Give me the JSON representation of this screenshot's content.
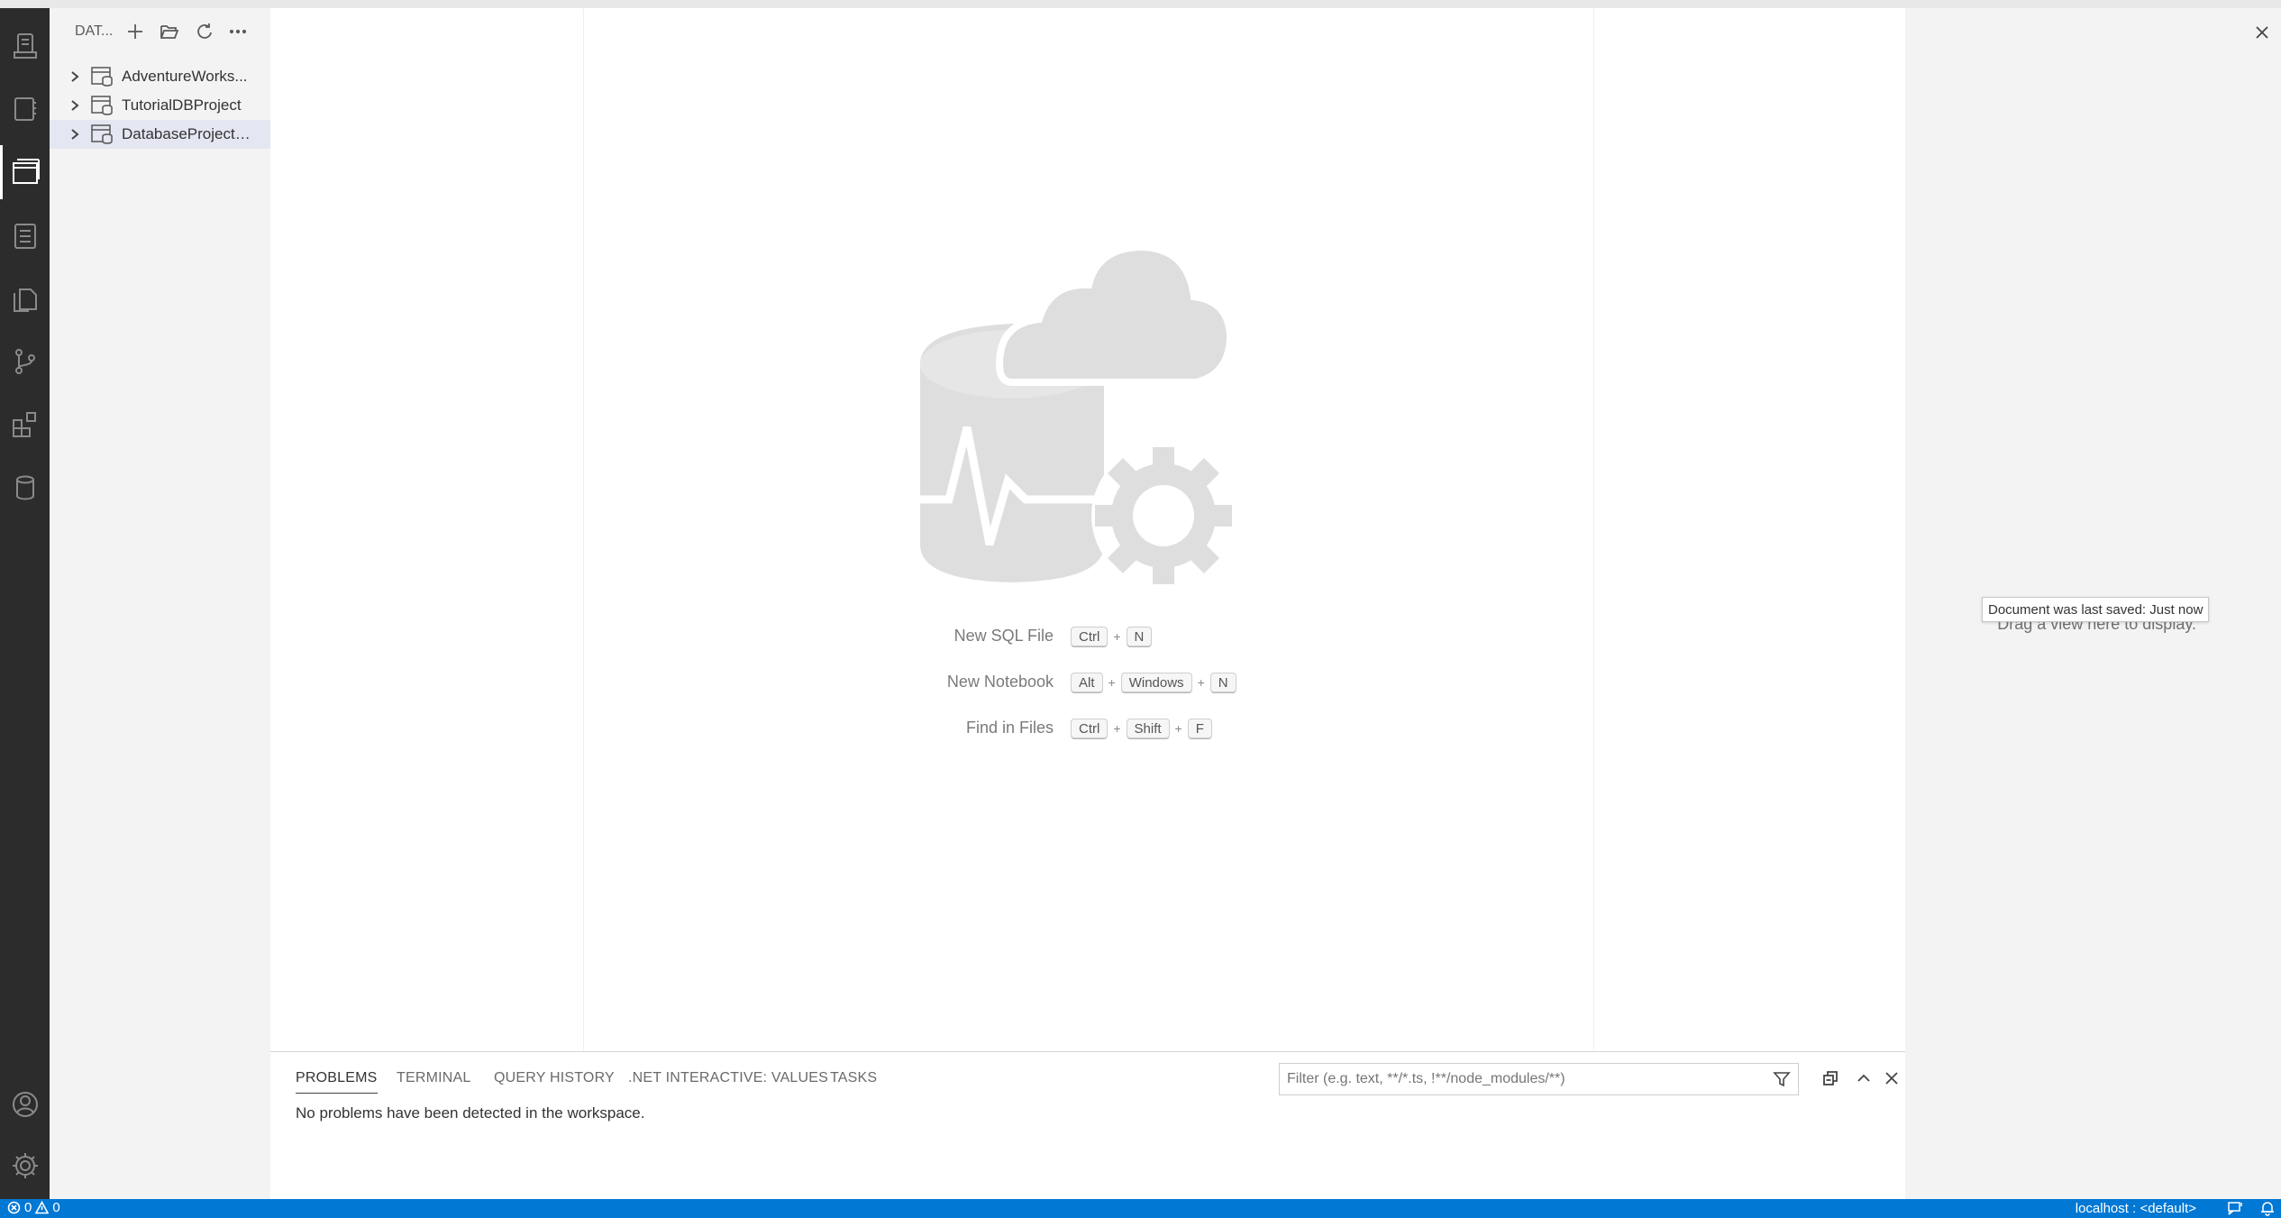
{
  "sidebar": {
    "title": "DAT...",
    "actions": [
      "new-project",
      "open-project",
      "refresh",
      "more"
    ],
    "items": [
      {
        "label": "AdventureWorks..."
      },
      {
        "label": "TutorialDBProject"
      },
      {
        "label": "DatabaseProjectT..."
      }
    ]
  },
  "welcome": {
    "shortcuts": [
      {
        "label": "New SQL File",
        "keys": [
          "Ctrl",
          "N"
        ]
      },
      {
        "label": "New Notebook",
        "keys": [
          "Alt",
          "Windows",
          "N"
        ]
      },
      {
        "label": "Find in Files",
        "keys": [
          "Ctrl",
          "Shift",
          "F"
        ]
      }
    ],
    "plus": "+"
  },
  "right_panel": {
    "drag_hint": "Drag a view here to display.",
    "tooltip": "Document was last saved: Just now"
  },
  "panel": {
    "tabs": [
      {
        "label": "PROBLEMS",
        "active": true
      },
      {
        "label": "TERMINAL",
        "active": false
      },
      {
        "label": "QUERY HISTORY",
        "active": false
      },
      {
        "label": ".NET INTERACTIVE: VALUES",
        "active": false
      },
      {
        "label": "TASKS",
        "active": false
      }
    ],
    "filter_placeholder": "Filter (e.g. text, **/*.ts, !**/node_modules/**)",
    "message": "No problems have been detected in the workspace."
  },
  "statusbar": {
    "errors": "0",
    "warnings": "0",
    "connection": "localhost : <default>"
  },
  "colors": {
    "accent": "#0078d4",
    "activity_bar": "#2c2c2c",
    "sidebar": "#f3f3f3",
    "selection": "#e4e6f1"
  }
}
